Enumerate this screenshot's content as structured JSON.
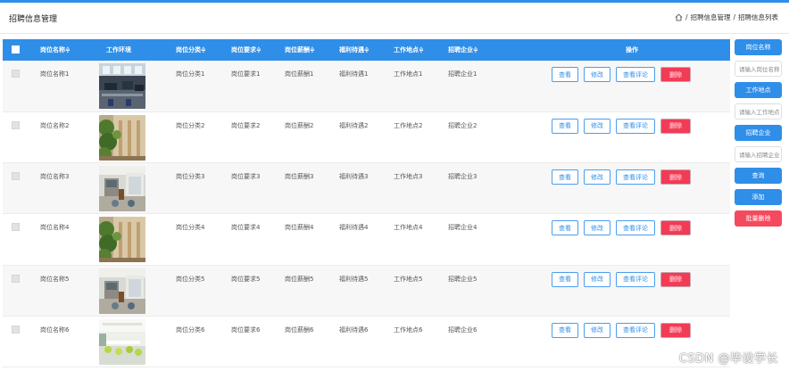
{
  "header": {
    "title": "招聘信息管理",
    "breadcrumb": [
      "招聘信息管理",
      "招聘信息列表"
    ],
    "breadcrumb_sep": "/"
  },
  "table": {
    "columns": [
      "岗位名称≑",
      "工作环境",
      "岗位分类≑",
      "岗位要求≑",
      "岗位薪酬≑",
      "福利待遇≑",
      "工作地点≑",
      "招聘企业≑",
      "操作"
    ],
    "rows": [
      {
        "name": "岗位名称1",
        "category": "岗位分类1",
        "requirement": "岗位要求1",
        "salary": "岗位薪酬1",
        "welfare": "福利待遇1",
        "location": "工作地点1",
        "company": "招聘企业1",
        "img": "office"
      },
      {
        "name": "岗位名称2",
        "category": "岗位分类2",
        "requirement": "岗位要求2",
        "salary": "岗位薪酬2",
        "welfare": "福利待遇2",
        "location": "工作地点2",
        "company": "招聘企业2",
        "img": "plants"
      },
      {
        "name": "岗位名称3",
        "category": "岗位分类3",
        "requirement": "岗位要求3",
        "salary": "岗位薪酬3",
        "welfare": "福利待遇3",
        "location": "工作地点3",
        "company": "招聘企业3",
        "img": "room"
      },
      {
        "name": "岗位名称4",
        "category": "岗位分类4",
        "requirement": "岗位要求4",
        "salary": "岗位薪酬4",
        "welfare": "福利待遇4",
        "location": "工作地点4",
        "company": "招聘企业4",
        "img": "plants"
      },
      {
        "name": "岗位名称5",
        "category": "岗位分类5",
        "requirement": "岗位要求5",
        "salary": "岗位薪酬5",
        "welfare": "福利待遇5",
        "location": "工作地点5",
        "company": "招聘企业5",
        "img": "room"
      },
      {
        "name": "岗位名称6",
        "category": "岗位分类6",
        "requirement": "岗位要求6",
        "salary": "岗位薪酬6",
        "welfare": "福利待遇6",
        "location": "工作地点6",
        "company": "招聘企业6",
        "img": "bright"
      }
    ],
    "actions": {
      "view": "查看",
      "edit": "修改",
      "comments": "查看评论",
      "delete": "删除"
    }
  },
  "sidebar": {
    "name_label": "岗位名称",
    "name_placeholder": "请输入岗位名称",
    "location_label": "工作地点",
    "location_placeholder": "请输入工作地点",
    "company_label": "招聘企业",
    "company_placeholder": "请输入招聘企业",
    "search": "查询",
    "add": "添加",
    "batch_delete": "批量删除"
  },
  "watermark": "CSDN @毕设学长",
  "colors": {
    "primary": "#2f8ee8",
    "danger": "#f23b55"
  }
}
